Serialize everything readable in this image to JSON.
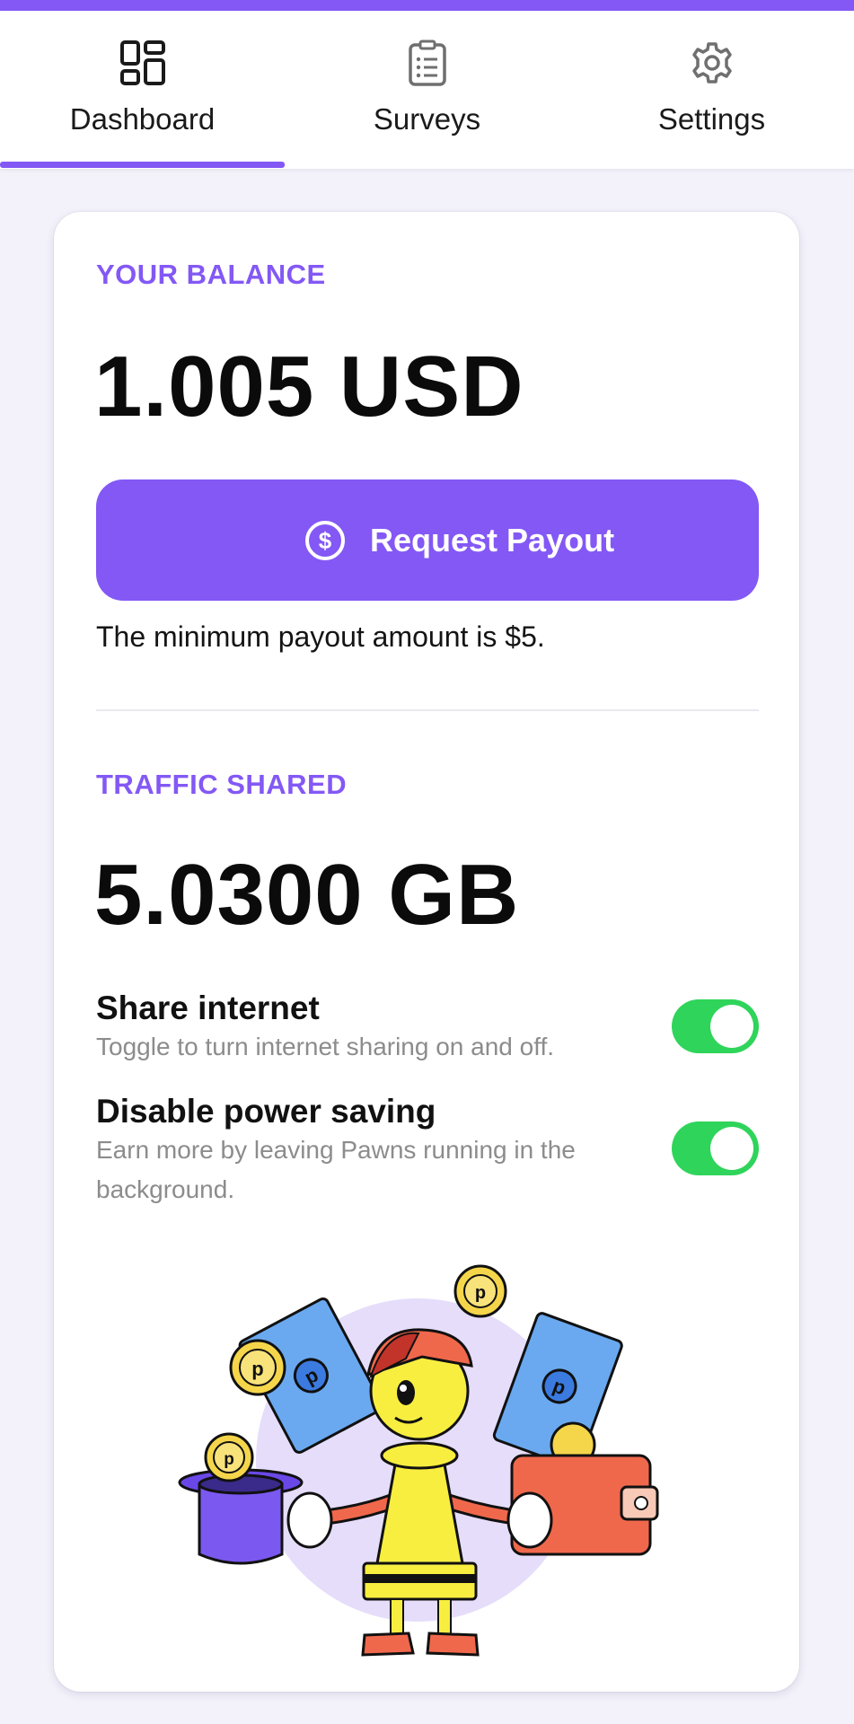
{
  "tabs": [
    {
      "label": "Dashboard",
      "icon": "dashboard-icon",
      "active": true
    },
    {
      "label": "Surveys",
      "icon": "clipboard-icon",
      "active": false
    },
    {
      "label": "Settings",
      "icon": "gear-icon",
      "active": false
    }
  ],
  "balance": {
    "label": "YOUR BALANCE",
    "value": "1.005 USD",
    "payout_button": "Request Payout",
    "note": "The minimum payout amount is $5."
  },
  "traffic": {
    "label": "TRAFFIC SHARED",
    "value": "5.0300 GB"
  },
  "settings": [
    {
      "title": "Share internet",
      "description": "Toggle to turn internet sharing on and off.",
      "enabled": true
    },
    {
      "title": "Disable power saving",
      "description": "Earn more by leaving Pawns running in the background.",
      "enabled": true
    }
  ],
  "colors": {
    "accent": "#8358f5",
    "toggle_on": "#2fd45a",
    "background": "#f3f2fa"
  }
}
